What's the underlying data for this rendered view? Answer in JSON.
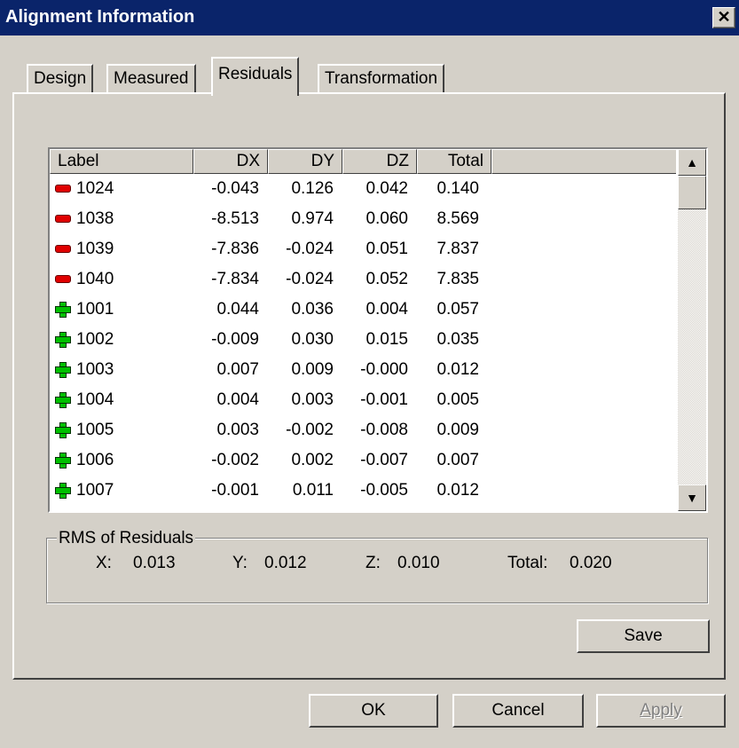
{
  "window": {
    "title": "Alignment Information",
    "close_glyph": "✕"
  },
  "tabs": [
    {
      "label": "Design",
      "active": false
    },
    {
      "label": "Measured",
      "active": false
    },
    {
      "label": "Residuals",
      "active": true
    },
    {
      "label": "Transformation",
      "active": false
    }
  ],
  "table": {
    "headers": [
      "Label",
      "DX",
      "DY",
      "DZ",
      "Total"
    ],
    "rows": [
      {
        "status": "minus",
        "label": "1024",
        "dx": "-0.043",
        "dy": "0.126",
        "dz": "0.042",
        "total": "0.140"
      },
      {
        "status": "minus",
        "label": "1038",
        "dx": "-8.513",
        "dy": "0.974",
        "dz": "0.060",
        "total": "8.569"
      },
      {
        "status": "minus",
        "label": "1039",
        "dx": "-7.836",
        "dy": "-0.024",
        "dz": "0.051",
        "total": "7.837"
      },
      {
        "status": "minus",
        "label": "1040",
        "dx": "-7.834",
        "dy": "-0.024",
        "dz": "0.052",
        "total": "7.835"
      },
      {
        "status": "plus",
        "label": "1001",
        "dx": "0.044",
        "dy": "0.036",
        "dz": "0.004",
        "total": "0.057"
      },
      {
        "status": "plus",
        "label": "1002",
        "dx": "-0.009",
        "dy": "0.030",
        "dz": "0.015",
        "total": "0.035"
      },
      {
        "status": "plus",
        "label": "1003",
        "dx": "0.007",
        "dy": "0.009",
        "dz": "-0.000",
        "total": "0.012"
      },
      {
        "status": "plus",
        "label": "1004",
        "dx": "0.004",
        "dy": "0.003",
        "dz": "-0.001",
        "total": "0.005"
      },
      {
        "status": "plus",
        "label": "1005",
        "dx": "0.003",
        "dy": "-0.002",
        "dz": "-0.008",
        "total": "0.009"
      },
      {
        "status": "plus",
        "label": "1006",
        "dx": "-0.002",
        "dy": "0.002",
        "dz": "-0.007",
        "total": "0.007"
      },
      {
        "status": "plus",
        "label": "1007",
        "dx": "-0.001",
        "dy": "0.011",
        "dz": "-0.005",
        "total": "0.012"
      }
    ]
  },
  "rms": {
    "title": "RMS of Residuals",
    "x_label": "X:",
    "x_value": "0.013",
    "y_label": "Y:",
    "y_value": "0.012",
    "z_label": "Z:",
    "z_value": "0.010",
    "total_label": "Total:",
    "total_value": "0.020"
  },
  "buttons": {
    "save": "Save",
    "ok": "OK",
    "cancel": "Cancel",
    "apply": "Apply"
  },
  "colors": {
    "titlebar": "#0a246a",
    "face": "#d4d0c8",
    "minus_icon": "#e00000",
    "plus_icon": "#00c000"
  }
}
